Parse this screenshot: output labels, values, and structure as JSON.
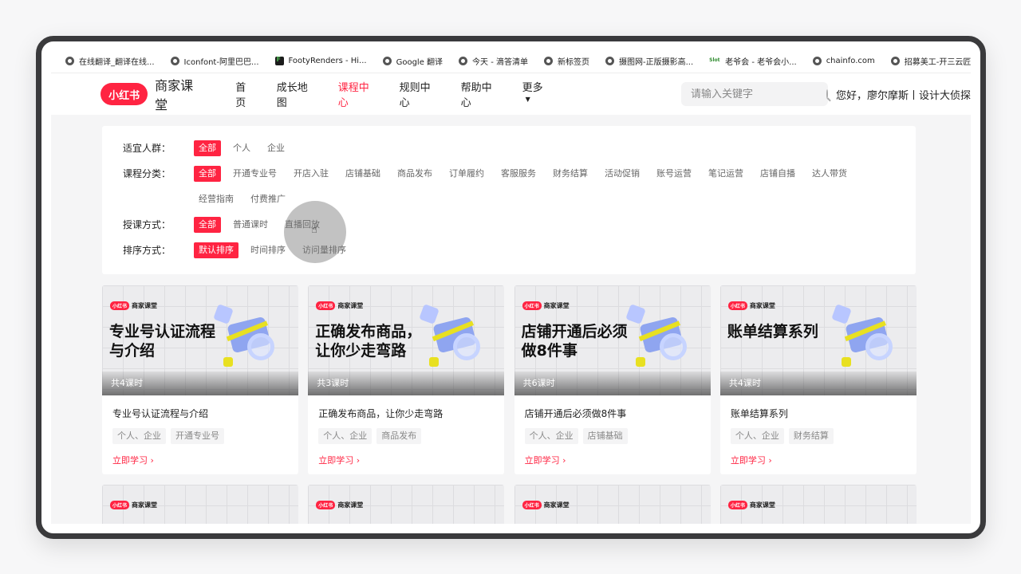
{
  "bookmarks": [
    {
      "label": "在线翻译_翻译在线...",
      "icon": "globe"
    },
    {
      "label": "Iconfont-阿里巴巴...",
      "icon": "globe"
    },
    {
      "label": "FootyRenders - Hi...",
      "icon": "fr"
    },
    {
      "label": "Google 翻译",
      "icon": "globe"
    },
    {
      "label": "今天 - 滴答清单",
      "icon": "globe"
    },
    {
      "label": "新标签页",
      "icon": "globe"
    },
    {
      "label": "摄图网-正版摄影高...",
      "icon": "globe"
    },
    {
      "label": "老爷会 - 老爷会小...",
      "icon": "lyh"
    },
    {
      "label": "chainfo.com",
      "icon": "globe"
    },
    {
      "label": "招募美工-开三云匠...",
      "icon": "globe"
    }
  ],
  "bookmarks_more": "»",
  "header": {
    "logo_badge": "小红书",
    "logo_text": "商家课堂",
    "nav": [
      "首页",
      "成长地图",
      "课程中心",
      "规则中心",
      "帮助中心"
    ],
    "nav_more": "更多",
    "nav_more_caret": "▼",
    "search_placeholder": "请输入关键字",
    "greeting": "您好，廖尔摩斯丨设计大侦探"
  },
  "filters": [
    {
      "label": "适宜人群：",
      "options": [
        "全部",
        "个人",
        "企业"
      ],
      "selected": 0
    },
    {
      "label": "课程分类：",
      "options": [
        "全部",
        "开通专业号",
        "开店入驻",
        "店铺基础",
        "商品发布",
        "订单履约",
        "客服服务",
        "财务结算",
        "活动促销",
        "账号运营",
        "笔记运营",
        "店铺自播",
        "达人带货",
        "经营指南",
        "付费推广"
      ],
      "selected": 0
    },
    {
      "label": "授课方式：",
      "options": [
        "全部",
        "普通课时",
        "直播回放"
      ],
      "selected": 0
    },
    {
      "label": "排序方式：",
      "options": [
        "默认排序",
        "时间排序",
        "访问量排序"
      ],
      "selected": 0
    }
  ],
  "cursor": "☝",
  "thumb_brand": {
    "badge": "小红书",
    "text": "商家课堂"
  },
  "cards": [
    {
      "thumb_title": "专业号认证流程与介绍",
      "count": "共4课时",
      "title": "专业号认证流程与介绍",
      "tags": [
        "个人、企业",
        "开通专业号"
      ],
      "cta": "立即学习 ›"
    },
    {
      "thumb_title": "正确发布商品，让你少走弯路",
      "count": "共3课时",
      "title": "正确发布商品，让你少走弯路",
      "tags": [
        "个人、企业",
        "商品发布"
      ],
      "cta": "立即学习 ›"
    },
    {
      "thumb_title": "店铺开通后必须做8件事",
      "count": "共6课时",
      "title": "店铺开通后必须做8件事",
      "tags": [
        "个人、企业",
        "店铺基础"
      ],
      "cta": "立即学习 ›"
    },
    {
      "thumb_title": "账单结算系列",
      "count": "共4课时",
      "title": "账单结算系列",
      "tags": [
        "个人、企业",
        "财务结算"
      ],
      "cta": "立即学习 ›"
    }
  ],
  "colors": {
    "brand": "#ff2442",
    "accent_yellow": "#e8e021",
    "accent_blue": "#8fa5f0"
  }
}
